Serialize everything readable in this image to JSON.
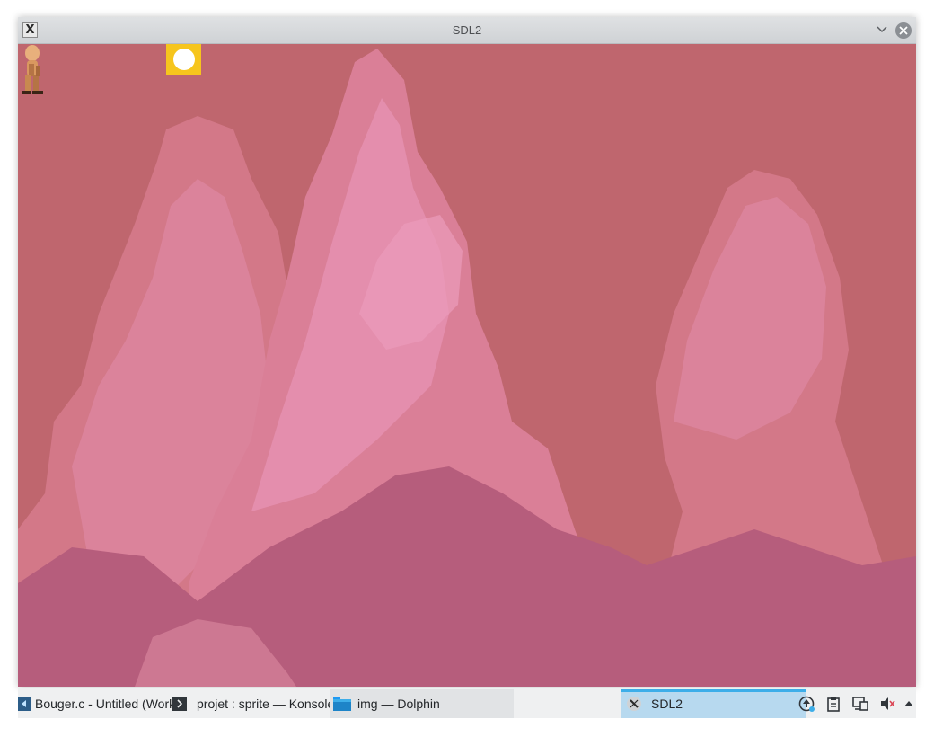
{
  "window": {
    "title": "SDL2",
    "app_icon_glyph": "X"
  },
  "scene": {
    "sky_color": "#bf666e",
    "cloud_colors": [
      "#d5788a",
      "#e68fb0",
      "#b45c7a"
    ],
    "sun_box_color": "#f6c51d",
    "sun_color": "#ffffff"
  },
  "taskbar": {
    "tasks": [
      {
        "label": "Bouger.c - Untitled (Workspace)",
        "icon": "kate-editor-icon"
      },
      {
        "label": "projet : sprite — Konsole",
        "icon": "terminal-icon"
      },
      {
        "label": "img — Dolphin",
        "icon": "folder-icon"
      },
      {
        "label": "SDL2",
        "icon": "x-app-icon",
        "active": true
      }
    ],
    "tray": [
      "updates-icon",
      "clipboard-icon",
      "network-icon",
      "volume-muted-icon",
      "expand-tray-icon"
    ],
    "accent_color": "#3daee9"
  }
}
